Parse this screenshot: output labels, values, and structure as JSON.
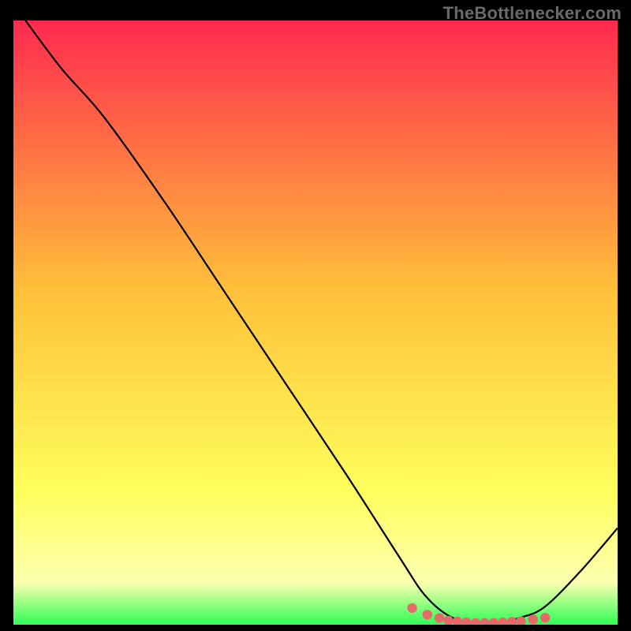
{
  "watermark": "TheBottlenecker.com",
  "chart_data": {
    "type": "line",
    "title": "",
    "xlabel": "",
    "ylabel": "",
    "xlim": [
      0,
      100
    ],
    "ylim": [
      0,
      100
    ],
    "curve": [
      {
        "x": 2,
        "y": 100
      },
      {
        "x": 8,
        "y": 92
      },
      {
        "x": 15,
        "y": 84
      },
      {
        "x": 25,
        "y": 70
      },
      {
        "x": 35,
        "y": 55
      },
      {
        "x": 45,
        "y": 40
      },
      {
        "x": 55,
        "y": 25
      },
      {
        "x": 64,
        "y": 11
      },
      {
        "x": 68,
        "y": 5
      },
      {
        "x": 72,
        "y": 1.5
      },
      {
        "x": 76,
        "y": 0.3
      },
      {
        "x": 80,
        "y": 0.3
      },
      {
        "x": 84,
        "y": 1.2
      },
      {
        "x": 88,
        "y": 3
      },
      {
        "x": 94,
        "y": 9
      },
      {
        "x": 100,
        "y": 16
      }
    ],
    "valley_markers_x": [
      66,
      68.5,
      70.5,
      72,
      73.5,
      75,
      76.5,
      78,
      79.5,
      81,
      82.5,
      84,
      86,
      88
    ],
    "valley_marker_y_scale": 0.32,
    "colors": {
      "gradient_top": "#ff2a4f",
      "gradient_mid": "#ffc13a",
      "gradient_yellow": "#feff5c",
      "gradient_pale": "#feffb0",
      "gradient_green": "#2dff55",
      "curve_stroke": "#000000",
      "marker_fill": "#e46a6a"
    }
  }
}
